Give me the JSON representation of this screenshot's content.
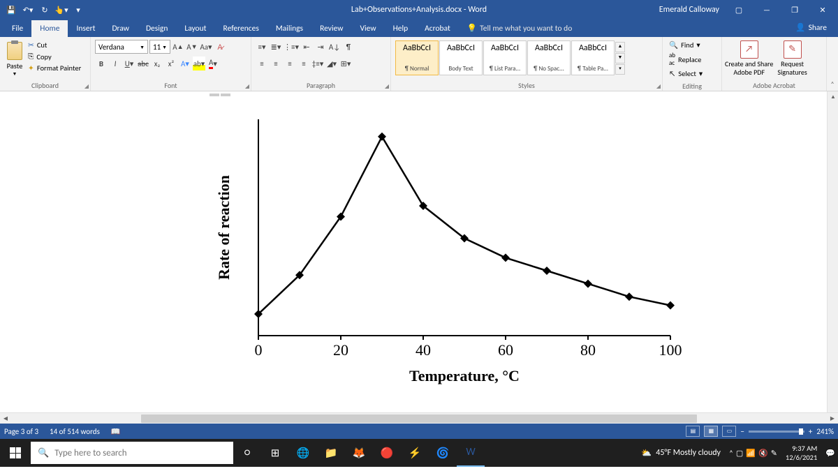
{
  "title": "Lab+Observations+Analysis.docx  -  Word",
  "user": "Emerald Calloway",
  "tabs": [
    "File",
    "Home",
    "Insert",
    "Draw",
    "Design",
    "Layout",
    "References",
    "Mailings",
    "Review",
    "View",
    "Help",
    "Acrobat"
  ],
  "tellMe": "Tell me what you want to do",
  "share": "Share",
  "clipboard": {
    "label": "Clipboard",
    "paste": "Paste",
    "cut": "Cut",
    "copy": "Copy",
    "painter": "Format Painter"
  },
  "font": {
    "label": "Font",
    "name": "Verdana",
    "size": "11"
  },
  "paragraph": {
    "label": "Paragraph"
  },
  "styles": {
    "label": "Styles",
    "items": [
      {
        "preview": "AaBbCcI",
        "name": "¶ Normal"
      },
      {
        "preview": "AaBbCcI",
        "name": "Body Text"
      },
      {
        "preview": "AaBbCcI",
        "name": "¶ List Para..."
      },
      {
        "preview": "AaBbCcI",
        "name": "¶ No Spac..."
      },
      {
        "preview": "AaBbCcI",
        "name": "¶ Table Pa..."
      }
    ]
  },
  "editing": {
    "label": "Editing",
    "find": "Find",
    "replace": "Replace",
    "select": "Select"
  },
  "acrobat": {
    "label": "Adobe Acrobat",
    "share": "Create and Share\nAdobe PDF",
    "request": "Request\nSignatures"
  },
  "status": {
    "page": "Page 3 of 3",
    "words": "14 of 514 words",
    "zoom": "241%"
  },
  "taskbar": {
    "search": "Type here to search",
    "weather": "45°F Mostly cloudy",
    "time": "9:37 AM",
    "date": "12/6/2021"
  },
  "chart_data": {
    "type": "line",
    "title": "",
    "xlabel": "Temperature, °C",
    "ylabel": "Rate of reaction",
    "xlim": [
      0,
      100
    ],
    "ylim": [
      0,
      100
    ],
    "x": [
      0,
      10,
      20,
      30,
      40,
      50,
      60,
      70,
      80,
      90,
      100
    ],
    "y": [
      10,
      28,
      55,
      92,
      60,
      45,
      36,
      30,
      24,
      18,
      14
    ]
  }
}
